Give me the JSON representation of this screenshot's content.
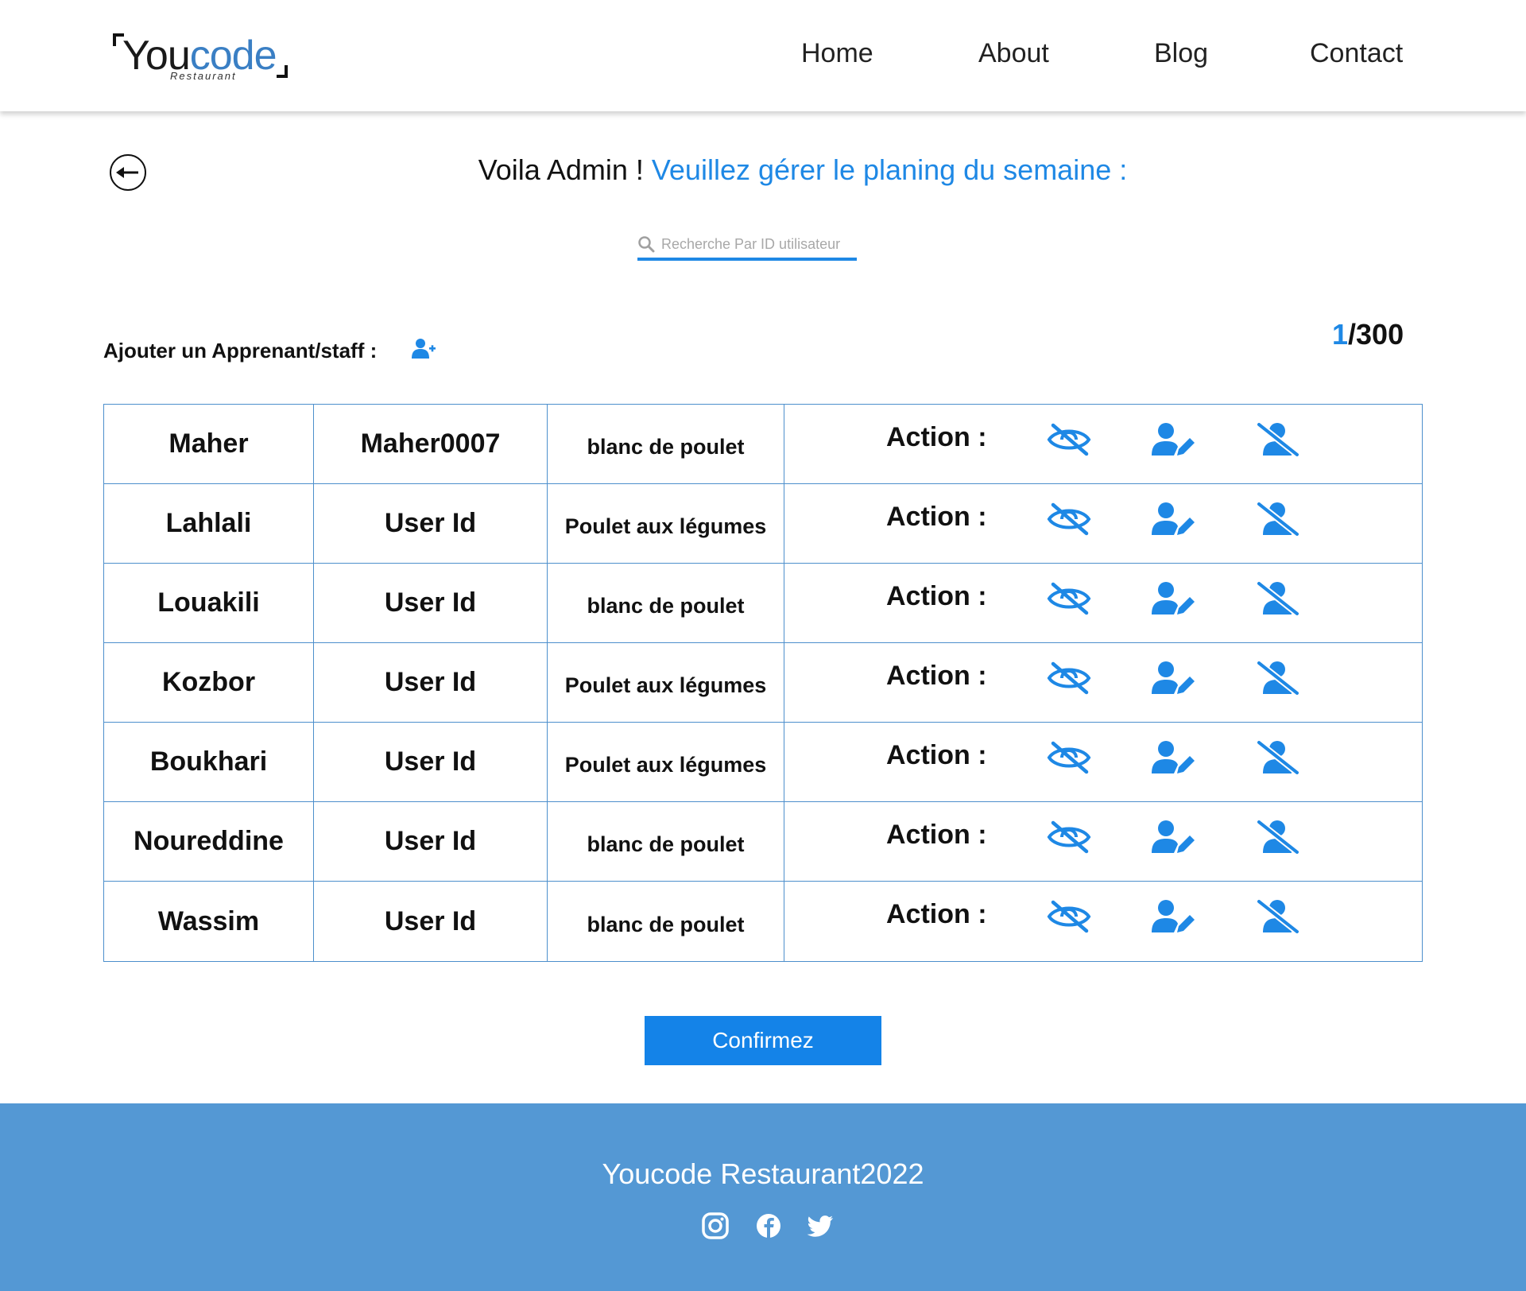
{
  "brand": {
    "logo_dark": "You",
    "logo_blue": "code",
    "logo_sub": "Restaurant"
  },
  "nav": {
    "home": "Home",
    "about": "About",
    "blog": "Blog",
    "contact": "Contact"
  },
  "title": {
    "prefix": "Voila Admin ! ",
    "highlight": "Veuillez gérer le planing du semaine :"
  },
  "search": {
    "placeholder": "Recherche Par ID utilisateur"
  },
  "add": {
    "label": "Ajouter un Apprenant/staff :"
  },
  "counter": {
    "current": "1",
    "total": "/300"
  },
  "table": {
    "action_label": "Action :",
    "rows": [
      {
        "name": "Maher",
        "user_id": "Maher0007",
        "meal": "blanc de poulet"
      },
      {
        "name": "Lahlali",
        "user_id": "User Id",
        "meal": "Poulet aux légumes"
      },
      {
        "name": "Louakili",
        "user_id": "User Id",
        "meal": "blanc de poulet"
      },
      {
        "name": "Kozbor",
        "user_id": "User Id",
        "meal": "Poulet aux légumes"
      },
      {
        "name": "Boukhari",
        "user_id": "User Id",
        "meal": "Poulet aux légumes"
      },
      {
        "name": "Noureddine",
        "user_id": "User Id",
        "meal": "blanc de poulet"
      },
      {
        "name": "Wassim",
        "user_id": "User Id",
        "meal": "blanc de poulet"
      }
    ]
  },
  "confirm": {
    "label": "Confirmez"
  },
  "footer": {
    "text": "Youcode Restaurant2022",
    "social": [
      "instagram-icon",
      "facebook-icon",
      "twitter-icon"
    ]
  },
  "colors": {
    "accent": "#1e88e5",
    "table_border": "#4d8fcc",
    "footer_bg": "#5498d4",
    "button_bg": "#1483e8"
  }
}
